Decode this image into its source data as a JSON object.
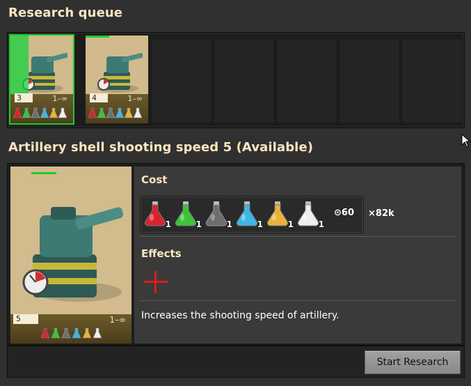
{
  "queue": {
    "title": "Research queue",
    "items": [
      {
        "level": "3",
        "range": "1–∞",
        "active": true
      },
      {
        "level": "4",
        "range": "1–∞",
        "active": false
      }
    ]
  },
  "detail": {
    "title": "Artillery shell shooting speed 5 (Available)",
    "card": {
      "level": "5",
      "range": "1–∞"
    },
    "cost": {
      "label": "Cost",
      "packs": [
        {
          "name": "automation-science-pack",
          "color": "#d8242e",
          "amount": "1"
        },
        {
          "name": "logistic-science-pack",
          "color": "#3fc23a",
          "amount": "1"
        },
        {
          "name": "military-science-pack",
          "color": "#6e6e70",
          "amount": "1"
        },
        {
          "name": "chemical-science-pack",
          "color": "#3db6e8",
          "amount": "1"
        },
        {
          "name": "utility-science-pack",
          "color": "#e8b23a",
          "amount": "1"
        },
        {
          "name": "space-science-pack",
          "color": "#e8e8e8",
          "amount": "1"
        }
      ],
      "time": "60",
      "count": "82k"
    },
    "effects": {
      "label": "Effects",
      "icon": "red-plus-icon",
      "description": "Increases the shooting speed of artillery."
    }
  },
  "actions": {
    "start_label": "Start Research"
  },
  "colors": {
    "heading": "#ffe6c0",
    "progress": "#1ecb2a",
    "card_bg": "#d1ba8c"
  }
}
